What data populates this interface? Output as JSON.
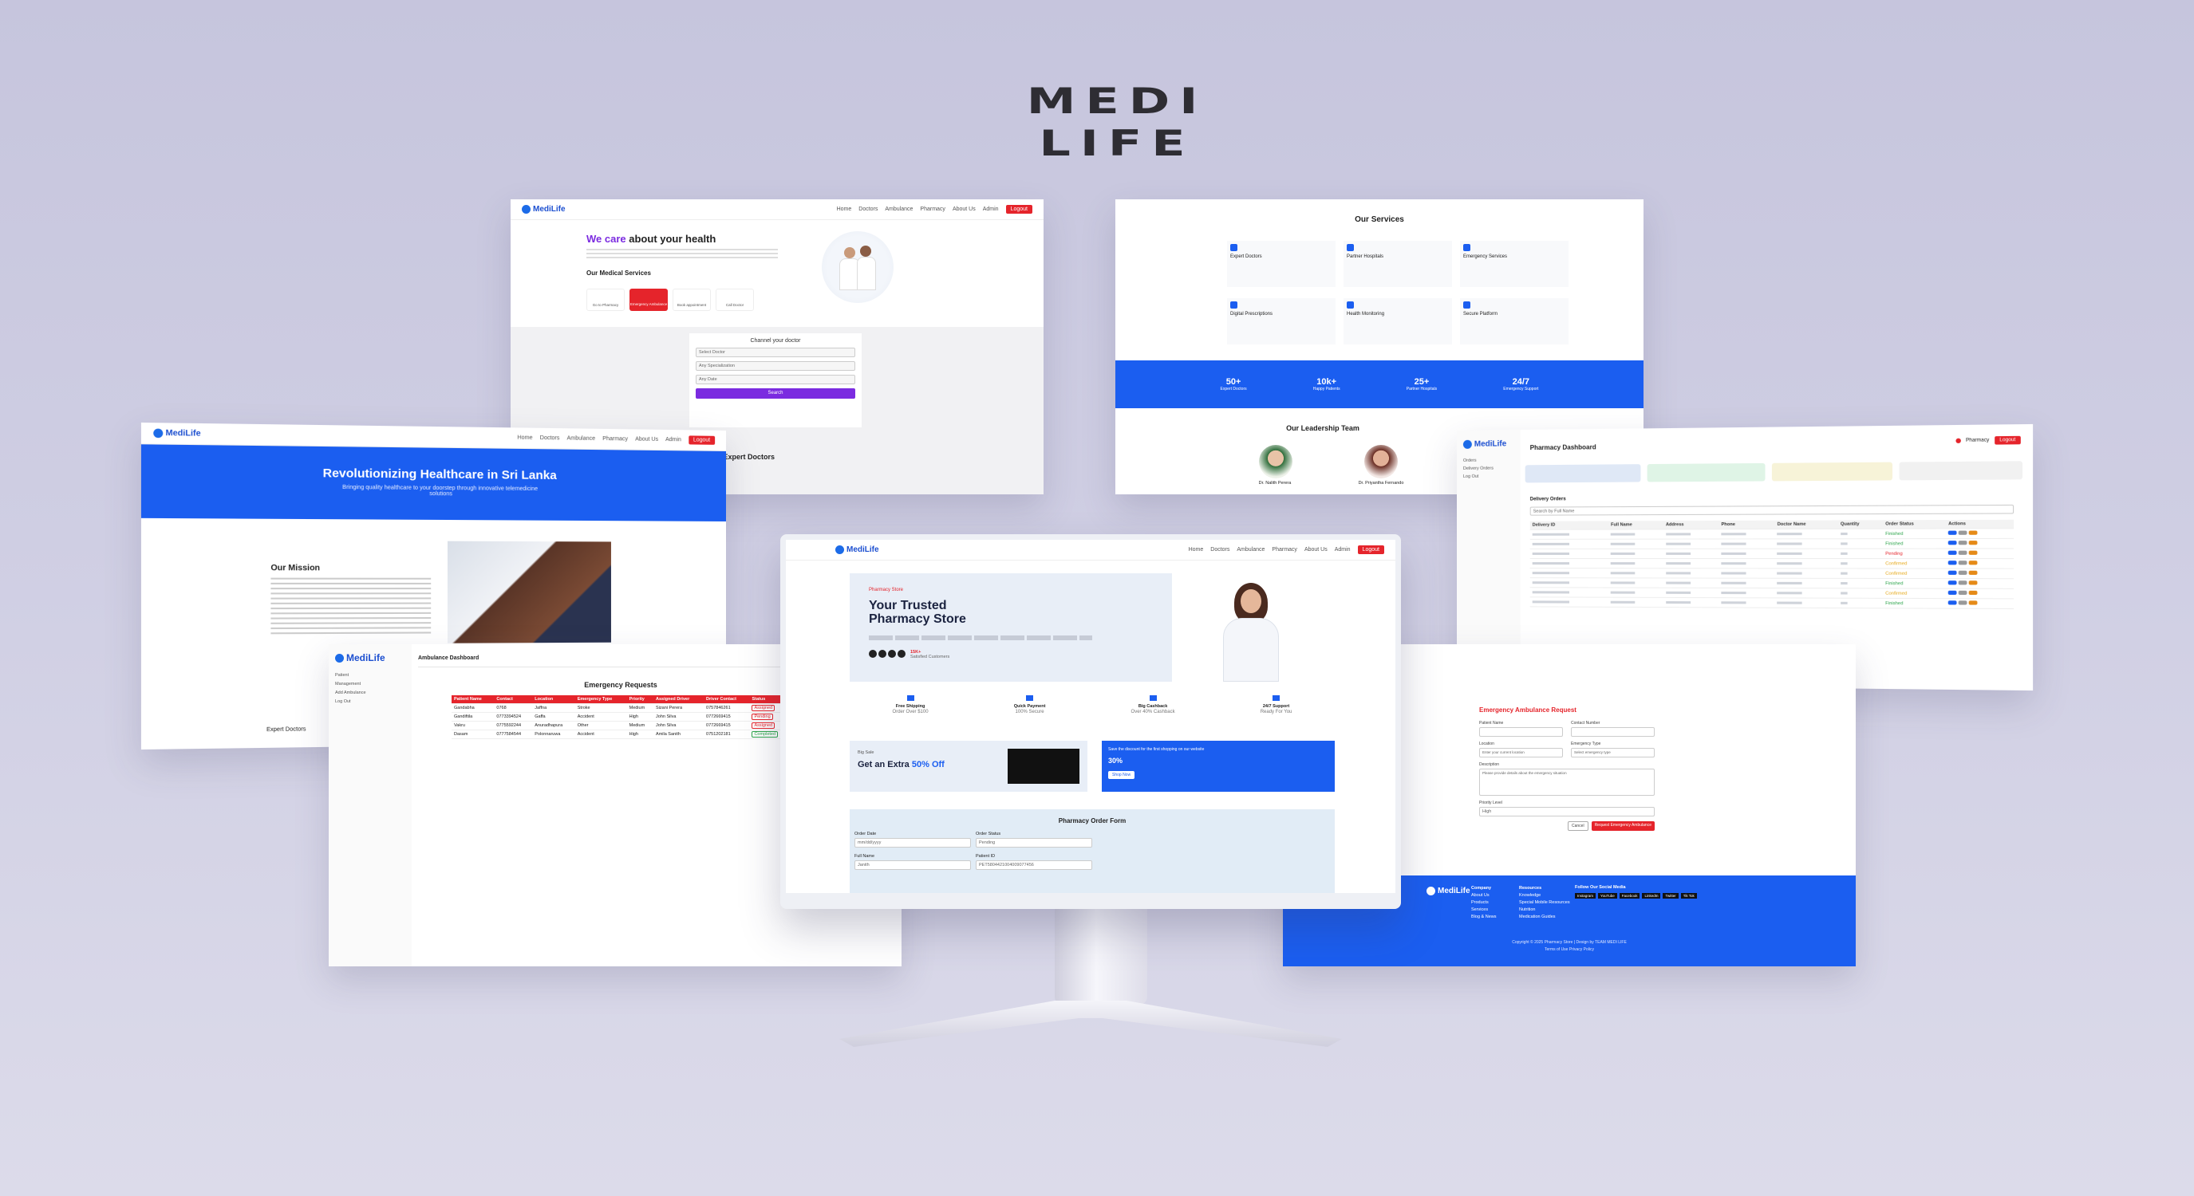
{
  "brand": "MEDI LIFE",
  "common": {
    "logo": "MediLife",
    "nav": [
      "Home",
      "Doctors",
      "Ambulance",
      "Pharmacy",
      "About Us"
    ],
    "admin": "Admin",
    "logout": "Logout"
  },
  "home": {
    "headline_accent": "We care",
    "headline_rest": "about your health",
    "services_title": "Our Medical Services",
    "service_buttons": [
      "Go to Pharmacy",
      "Emergency Ambulance",
      "Book appointment",
      "Call Doctor"
    ],
    "channel_title": "Channel your doctor",
    "channel_fields": [
      "Select Doctor",
      "Any Specialization",
      "Any Date"
    ],
    "search": "Search",
    "expert_doctors": "Our Expert Doctors"
  },
  "services": {
    "title": "Our Services",
    "items": [
      "Expert Doctors",
      "Partner Hospitals",
      "Emergency Services",
      "Digital Prescriptions",
      "Health Monitoring",
      "Secure Platform"
    ],
    "stats": [
      {
        "value": "50+",
        "label": "Expert Doctors"
      },
      {
        "value": "10k+",
        "label": "Happy Patients"
      },
      {
        "value": "25+",
        "label": "Partner Hospitals"
      },
      {
        "value": "24/7",
        "label": "Emergency Support"
      }
    ],
    "leadership_title": "Our Leadership Team",
    "leaders": [
      "Dr. Nalith Perera",
      "Dr. Priyantha Fernando"
    ]
  },
  "about": {
    "hero": "Revolutionizing Healthcare in Sri Lanka",
    "hero_sub": "Bringing quality healthcare to your doorstep through innovative telemedicine solutions",
    "mission": "Our Mission",
    "expert": "Expert Doctors"
  },
  "pharmacy_dash": {
    "title": "Pharmacy Dashboard",
    "user": "Pharmacy",
    "side": [
      "Orders",
      "Delivery Orders",
      "Log Out"
    ],
    "delivery_orders": "Delivery Orders",
    "search_placeholder": "Search by Full Name",
    "columns": [
      "Delivery ID",
      "Full Name",
      "Address",
      "Phone",
      "Doctor Name",
      "Quantity",
      "Order Status",
      "Actions"
    ],
    "statuses": [
      "Finished",
      "Finished",
      "Pending",
      "Confirmed",
      "Confirmed",
      "Finished",
      "Confirmed",
      "Finished"
    ]
  },
  "ambulance": {
    "title": "Ambulance Dashboard",
    "side": [
      "Patient",
      "Management",
      "Add Ambulance",
      "Log Out"
    ],
    "requests_title": "Emergency Requests",
    "columns": [
      "Patient Name",
      "Contact",
      "Location",
      "Emergency Type",
      "Priority",
      "Assigned Driver",
      "Driver Contact",
      "Status"
    ],
    "rows": [
      [
        "Gandabha",
        "0768",
        "Jaffna",
        "Stroke",
        "Medium",
        "Sizani Perera",
        "0757846261",
        "Assigned"
      ],
      [
        "Gandiftila",
        "0773394524",
        "Gaffa",
        "Accident",
        "High",
        "John Silva",
        "0772669415",
        "Pending"
      ],
      [
        "Vakru",
        "0775592244",
        "Anuradhapura",
        "Other",
        "Medium",
        "John Silva",
        "0772669415",
        "Assigned"
      ],
      [
        "Dasam",
        "0777584544",
        "Polonnaruwa",
        "Accident",
        "High",
        "Amila Sanith",
        "0751202181",
        "Completed"
      ]
    ]
  },
  "store": {
    "tag": "Pharmacy Store",
    "title_line1": "Your Trusted",
    "title_line2": "Pharmacy Store",
    "rating_text": "Satisfied Customers",
    "rating_value": "15K+",
    "features": [
      {
        "title": "Free Shipping",
        "sub": "Order Over $100"
      },
      {
        "title": "Quick Payment",
        "sub": "100% Secure"
      },
      {
        "title": "Big Cashback",
        "sub": "Over 40% Cashback"
      },
      {
        "title": "24/7 Support",
        "sub": "Ready For You"
      }
    ],
    "promo_tag": "Big Sale",
    "promo_title": "Get an Extra",
    "promo_highlight": "50% Off",
    "promo2_text": "Save the discount for the first shopping on our website",
    "promo2_value": "30%",
    "promo2_button": "Shop Now",
    "form_title": "Pharmacy Order Form",
    "form_labels": [
      "Order Date",
      "Order Status",
      "Full Name",
      "Patient ID"
    ],
    "form_values": [
      "mm/dd/yyyy",
      "Pending",
      "Janith",
      "PET5804421004009077456"
    ]
  },
  "emergency": {
    "title": "Emergency Ambulance Request",
    "labels": [
      "Patient Name",
      "Contact Number",
      "Location",
      "Emergency Type",
      "Description",
      "Priority Level"
    ],
    "location_ph": "Enter your current location",
    "type_ph": "Select emergency type",
    "desc_ph": "Please provide details about the emergency situation",
    "priority": "High",
    "cancel": "Cancel",
    "submit": "Request Emergency Ambulance"
  },
  "footer": {
    "cols": [
      "Company",
      "Resources",
      "Follow Our Social Media"
    ],
    "company_links": [
      "About Us",
      "Products",
      "Services",
      "Blog & News"
    ],
    "resource_links": [
      "Knowledge",
      "Special Mobile Resources",
      "Nutrition",
      "Medication Guides"
    ],
    "social": [
      "Instagram",
      "YouTube",
      "Facebook",
      "LinkedIn",
      "Twitter",
      "Tik Tok"
    ],
    "copyright": "Copyright © 2025 Pharmacy Store | Design by TEAM MEDI LIFE",
    "terms": "Terms of Use Privacy Policy"
  }
}
